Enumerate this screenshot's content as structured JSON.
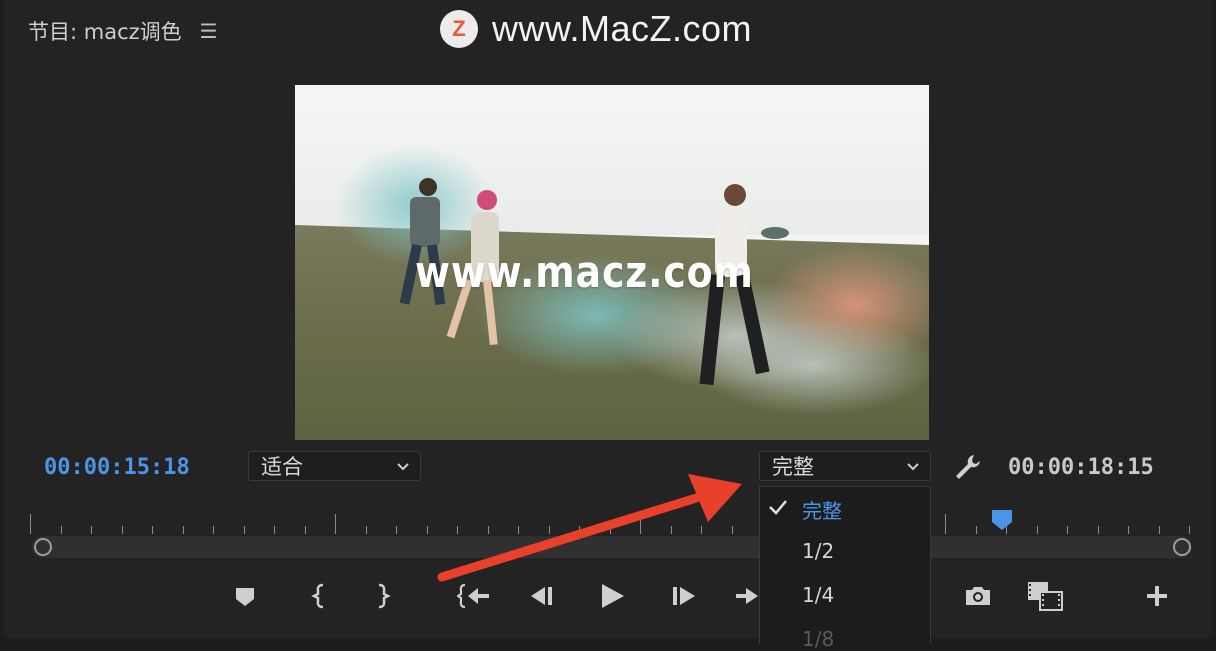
{
  "panel": {
    "title": "节目: macz调色",
    "menu_icon": "hamburger-icon"
  },
  "watermark": {
    "logo_letter": "Z",
    "text": "www.MacZ.com"
  },
  "video": {
    "overlay_text": "www.macz.com"
  },
  "timecode": {
    "current": "00:00:15:18",
    "duration": "00:00:18:15"
  },
  "fit_dropdown": {
    "value": "适合"
  },
  "resolution_dropdown": {
    "value": "完整",
    "options": [
      {
        "label": "完整",
        "selected": true
      },
      {
        "label": "1/2",
        "selected": false
      },
      {
        "label": "1/4",
        "selected": false
      },
      {
        "label": "1/8",
        "selected": false
      }
    ]
  },
  "controls": [
    "add-marker-icon",
    "mark-in-icon",
    "mark-out-icon",
    "go-to-in-icon",
    "step-back-icon",
    "play-icon",
    "step-forward-icon",
    "go-to-out-icon",
    "export-frame-icon",
    "comparison-view-icon",
    "button-editor-icon"
  ],
  "colors": {
    "accent": "#4a96e6",
    "panel_bg": "#232323",
    "annotation_arrow": "#e8402a"
  }
}
